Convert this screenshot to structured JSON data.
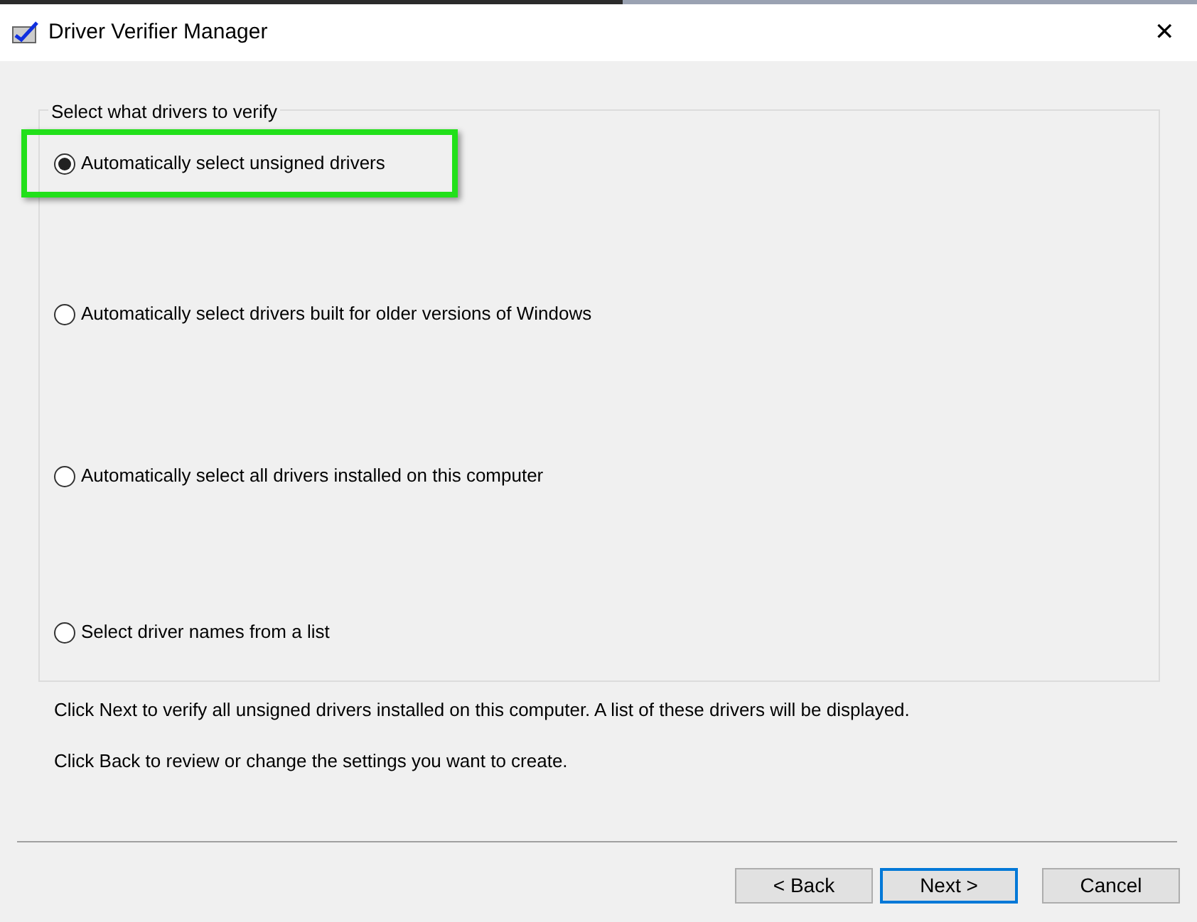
{
  "window": {
    "title": "Driver Verifier Manager",
    "close": "✕"
  },
  "group": {
    "legend": "Select what drivers to verify",
    "options": [
      {
        "label": "Automatically select unsigned drivers",
        "selected": true,
        "highlighted": true
      },
      {
        "label": "Automatically select drivers built for older versions of Windows",
        "selected": false,
        "highlighted": false
      },
      {
        "label": "Automatically select all drivers installed on this computer",
        "selected": false,
        "highlighted": false
      },
      {
        "label": "Select driver names from a list",
        "selected": false,
        "highlighted": false
      }
    ]
  },
  "notes": [
    "Click Next to verify all unsigned drivers installed on this computer. A list of these drivers will be displayed.",
    "Click Back to review or change the settings you want to create."
  ],
  "buttons": [
    {
      "label": "< Back",
      "default": false
    },
    {
      "label": "Next >",
      "default": true
    },
    {
      "label": "Cancel",
      "default": false
    }
  ]
}
